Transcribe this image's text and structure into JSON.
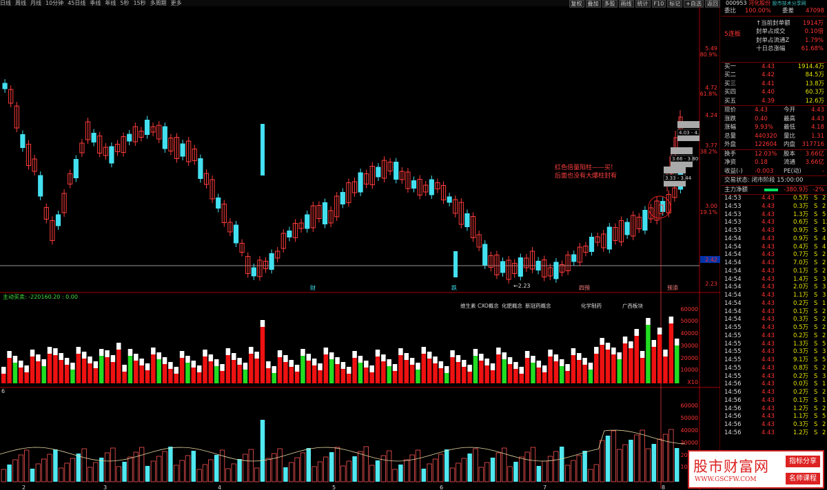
{
  "topbar": {
    "periods": [
      "日线",
      "周线",
      "月线",
      "10分钟",
      "45日线",
      "季线",
      "年线",
      "5秒",
      "15秒",
      "多周期",
      "更多"
    ],
    "tools": [
      "复权",
      "叠加",
      "多股",
      "画线",
      "统计",
      "F10",
      "标记",
      "+自选",
      "返回"
    ]
  },
  "stock": {
    "code": "000953",
    "name": "河化股份",
    "tag": "股市技术分享网"
  },
  "main": {
    "price_labels": [
      "5.49",
      "80.9%",
      "4.72",
      "61.8%",
      "4.24",
      "3.77",
      "38.2%",
      "3.00",
      "19.1%",
      "2.42",
      "2.23"
    ],
    "annotations": {
      "note1": "红色倍量阳柱——买!",
      "note2": "后面也没有大爆柱封有",
      "low_label": "←2.23",
      "box1": "4.03 - 4.",
      "box2": "3.66 - 3.80",
      "box3": "3.33 - 3.44"
    },
    "markers": [
      "财",
      "跌",
      "四预",
      "预添"
    ]
  },
  "volume": {
    "header": "主动买卖: -220160.20 : 0.00",
    "concepts": [
      "维生素",
      "CXO概念",
      "化肥概念",
      "新冠药概念",
      "化学制药",
      "广西板块"
    ],
    "axis": [
      "60000",
      "50000",
      "40000",
      "30000",
      "20000",
      "10000",
      "X10"
    ]
  },
  "indicator": {
    "label": "6",
    "axis": [
      "60000",
      "50000",
      "40000",
      "30000",
      "20000",
      "10000"
    ],
    "dates": [
      "2",
      "3",
      "4",
      "5",
      "6",
      "7",
      "8"
    ]
  },
  "quote": {
    "wb_label": "委比",
    "wb_value": "100.00%",
    "wc_label": "委差",
    "wc_value": "47098",
    "board": "5连板",
    "seal_rows": [
      {
        "label": "↑当前封单额",
        "value": "1914万"
      },
      {
        "label": "封单占成交",
        "value": "0.10倍"
      },
      {
        "label": "封单占流通Z",
        "value": "1.79%"
      },
      {
        "label": "十日总涨幅",
        "value": "61.68%"
      }
    ],
    "bids": [
      {
        "label": "买一",
        "price": "4.43",
        "vol": "1914.4万"
      },
      {
        "label": "买二",
        "price": "4.42",
        "vol": "84.5万"
      },
      {
        "label": "买三",
        "price": "4.41",
        "vol": "13.8万"
      },
      {
        "label": "买四",
        "price": "4.40",
        "vol": "60.3万"
      },
      {
        "label": "买五",
        "price": "4.39",
        "vol": "12.6万"
      }
    ],
    "stats": [
      {
        "l1": "现价",
        "v1": "4.43",
        "l2": "今开",
        "v2": "4.43"
      },
      {
        "l1": "涨跌",
        "v1": "0.40",
        "l2": "最高",
        "v2": "4.43"
      },
      {
        "l1": "涨幅",
        "v1": "9.93%",
        "l2": "最低",
        "v2": "4.18"
      },
      {
        "l1": "总量",
        "v1": "440320",
        "l2": "量比",
        "v2": "1.31"
      },
      {
        "l1": "外盘",
        "v1": "122604",
        "l2": "内盘",
        "v2": "317716"
      }
    ],
    "stats2": [
      {
        "l1": "换手",
        "v1": "12.03%",
        "l2": "股本",
        "v2": "3.66亿"
      },
      {
        "l1": "净资",
        "v1": "0.18",
        "l2": "流通",
        "v2": "3.66亿"
      },
      {
        "l1": "收益(-)",
        "v1": "-0.003",
        "l2": "PE(动)",
        "v2": "-"
      }
    ],
    "status": "交易状态: 闭市阶段 15:00:00",
    "netflow_label": "主力净额",
    "netflow_value": "-380.9万",
    "netflow_pct": "-2%"
  },
  "ticks": [
    {
      "t": "14:53",
      "p": "4.43",
      "v": "0.5万",
      "s": "S",
      "x": "2"
    },
    {
      "t": "14:53",
      "p": "4.43",
      "v": "0.3万",
      "s": "S",
      "x": "2"
    },
    {
      "t": "14:53",
      "p": "4.43",
      "v": "1.3万",
      "s": "S",
      "x": "5"
    },
    {
      "t": "14:53",
      "p": "4.43",
      "v": "0.6万",
      "s": "S",
      "x": "13"
    },
    {
      "t": "14:53",
      "p": "4.43",
      "v": "0.9万",
      "s": "S",
      "x": "5"
    },
    {
      "t": "14:54",
      "p": "4.43",
      "v": "0.9万",
      "s": "S",
      "x": "4"
    },
    {
      "t": "14:54",
      "p": "4.43",
      "v": "0.4万",
      "s": "S",
      "x": "4"
    },
    {
      "t": "14:54",
      "p": "4.43",
      "v": "0.7万",
      "s": "S",
      "x": "2"
    },
    {
      "t": "14:54",
      "p": "4.43",
      "v": "7.0万",
      "s": "S",
      "x": "2"
    },
    {
      "t": "14:54",
      "p": "4.43",
      "v": "0.1万",
      "s": "S",
      "x": "2"
    },
    {
      "t": "14:54",
      "p": "4.43",
      "v": "1.4万",
      "s": "S",
      "x": "3"
    },
    {
      "t": "14:54",
      "p": "4.43",
      "v": "2.0万",
      "s": "S",
      "x": "3"
    },
    {
      "t": "14:54",
      "p": "4.43",
      "v": "1.1万",
      "s": "S",
      "x": "3"
    },
    {
      "t": "14:54",
      "p": "4.43",
      "v": "0.2万",
      "s": "S",
      "x": "1"
    },
    {
      "t": "14:54",
      "p": "4.43",
      "v": "0.1万",
      "s": "S",
      "x": "2"
    },
    {
      "t": "14:54",
      "p": "4.43",
      "v": "0.3万",
      "s": "S",
      "x": "2"
    },
    {
      "t": "14:55",
      "p": "4.43",
      "v": "0.5万",
      "s": "S",
      "x": "2"
    },
    {
      "t": "14:55",
      "p": "4.43",
      "v": "0.2万",
      "s": "S",
      "x": "2"
    },
    {
      "t": "14:55",
      "p": "4.43",
      "v": "1.3万",
      "s": "S",
      "x": "5"
    },
    {
      "t": "14:55",
      "p": "4.43",
      "v": "0.3万",
      "s": "S",
      "x": "3"
    },
    {
      "t": "14:55",
      "p": "4.43",
      "v": "9.1万",
      "s": "S",
      "x": "5"
    },
    {
      "t": "14:55",
      "p": "4.43",
      "v": "0.8万",
      "s": "S",
      "x": "2"
    },
    {
      "t": "14:55",
      "p": "4.43",
      "v": "0.2万",
      "s": "S",
      "x": "3"
    },
    {
      "t": "14:56",
      "p": "4.43",
      "v": "0.0万",
      "s": "S",
      "x": "1"
    },
    {
      "t": "14:56",
      "p": "4.43",
      "v": "0.2万",
      "s": "S",
      "x": "2"
    },
    {
      "t": "14:56",
      "p": "4.43",
      "v": "0.1万",
      "s": "S",
      "x": "1"
    },
    {
      "t": "14:56",
      "p": "4.43",
      "v": "1.2万",
      "s": "S",
      "x": "2"
    },
    {
      "t": "14:56",
      "p": "4.43",
      "v": "1.1万",
      "s": "S",
      "x": "5"
    },
    {
      "t": "14:56",
      "p": "4.43",
      "v": "0.3万",
      "s": "S",
      "x": "2"
    },
    {
      "t": "14:56",
      "p": "4.43",
      "v": "1.2万",
      "s": "S",
      "x": "2"
    }
  ],
  "watermark": {
    "title": "股市财富网",
    "url": "WWW.GSCFW.COM",
    "tag1": "指标分享",
    "tag2": "名师课程"
  }
}
